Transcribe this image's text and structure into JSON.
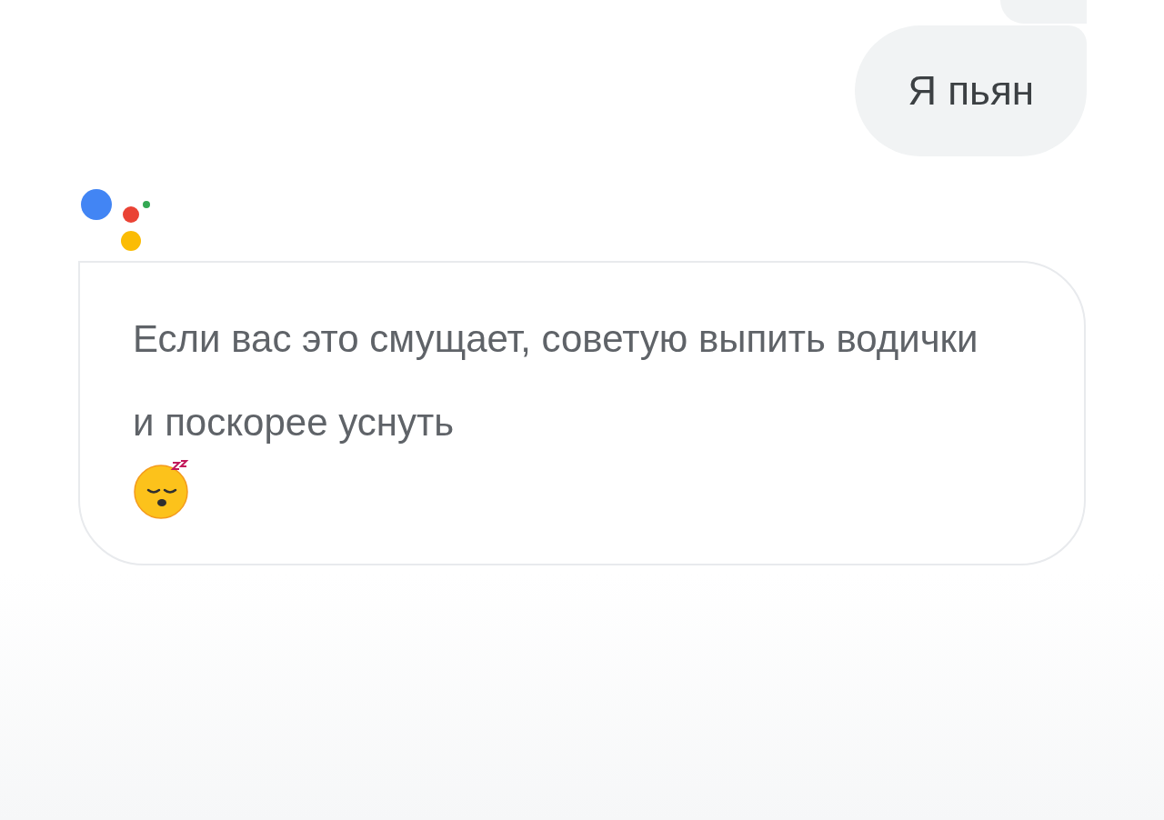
{
  "messages": [
    {
      "kind": "user",
      "text": "Я пьян"
    },
    {
      "kind": "assistant",
      "text": "Если вас это смущает, советую выпить водички и поскорее уснуть"
    }
  ]
}
